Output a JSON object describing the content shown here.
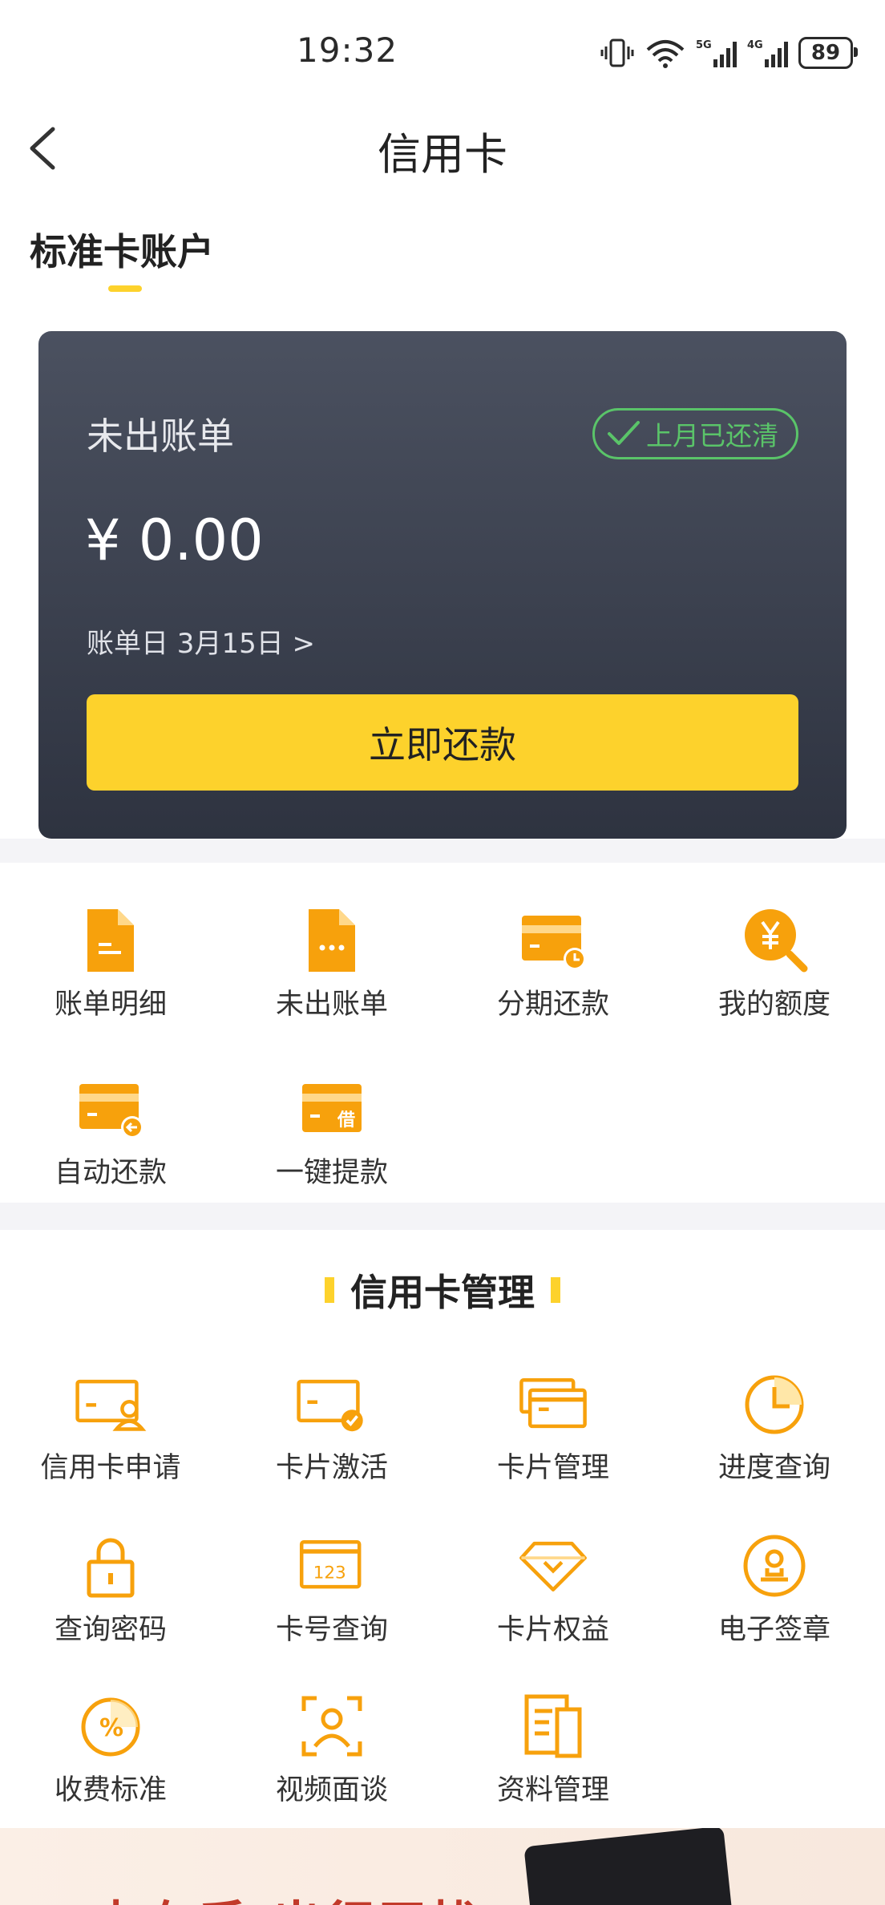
{
  "status_bar": {
    "time": "19:32",
    "battery": "89"
  },
  "header": {
    "title": "信用卡",
    "tab": "标准卡账户"
  },
  "card": {
    "label": "未出账单",
    "badge": "上月已还清",
    "amount": "¥ 0.00",
    "bill_date": "账单日 3月15日  >",
    "pay_button": "立即还款"
  },
  "quick_actions": [
    {
      "label": "账单明细",
      "icon": "document-icon"
    },
    {
      "label": "未出账单",
      "icon": "document-dots-icon"
    },
    {
      "label": "分期还款",
      "icon": "card-clock-icon"
    },
    {
      "label": "我的额度",
      "icon": "yuan-search-icon"
    },
    {
      "label": "自动还款",
      "icon": "card-return-icon"
    },
    {
      "label": "一键提款",
      "icon": "card-borrow-icon"
    }
  ],
  "management": {
    "title": "信用卡管理",
    "items": [
      {
        "label": "信用卡申请",
        "icon": "card-person-icon"
      },
      {
        "label": "卡片激活",
        "icon": "card-check-icon"
      },
      {
        "label": "卡片管理",
        "icon": "cards-stack-icon"
      },
      {
        "label": "进度查询",
        "icon": "clock-icon"
      },
      {
        "label": "查询密码",
        "icon": "lock-icon"
      },
      {
        "label": "卡号查询",
        "icon": "card-number-icon"
      },
      {
        "label": "卡片权益",
        "icon": "diamond-icon"
      },
      {
        "label": "电子签章",
        "icon": "stamp-icon"
      },
      {
        "label": "收费标准",
        "icon": "percent-icon"
      },
      {
        "label": "视频面谈",
        "icon": "video-person-icon"
      },
      {
        "label": "资料管理",
        "icon": "files-icon"
      }
    ]
  },
  "banner": {
    "text": "卡在手 出行无忧"
  },
  "colors": {
    "accent": "#fdd22c",
    "icon": "#f7a10c",
    "success": "#5ac469",
    "card_dark": "#2e3340"
  }
}
